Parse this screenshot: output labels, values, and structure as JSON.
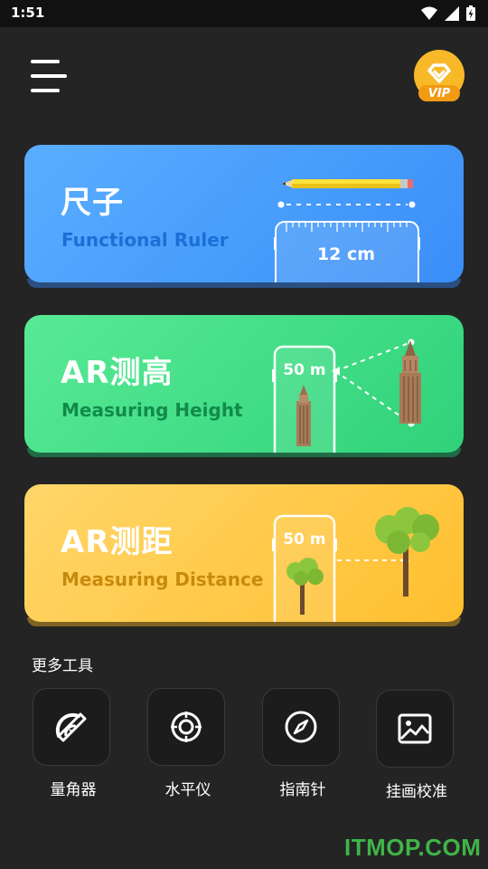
{
  "status_bar": {
    "time": "1:51"
  },
  "header": {
    "vip_label": "VIP"
  },
  "cards": [
    {
      "title": "尺子",
      "subtitle": "Functional Ruler",
      "measure": "12 cm"
    },
    {
      "title": "AR测高",
      "subtitle": "Measuring Height",
      "measure": "50 m"
    },
    {
      "title": "AR测距",
      "subtitle": "Measuring Distance",
      "measure": "50 m"
    }
  ],
  "more_tools": {
    "title": "更多工具",
    "items": [
      {
        "label": "量角器",
        "icon": "protractor-icon"
      },
      {
        "label": "水平仪",
        "icon": "level-target-icon"
      },
      {
        "label": "指南针",
        "icon": "compass-icon"
      },
      {
        "label": "挂画校准",
        "icon": "picture-icon"
      }
    ]
  },
  "watermark": "ITMOP.COM",
  "colors": {
    "background": "#242424",
    "card_blue": "#3a8ef8",
    "card_green": "#2fd27a",
    "card_yellow": "#ffbf2e",
    "vip_gold": "#f7b928"
  }
}
